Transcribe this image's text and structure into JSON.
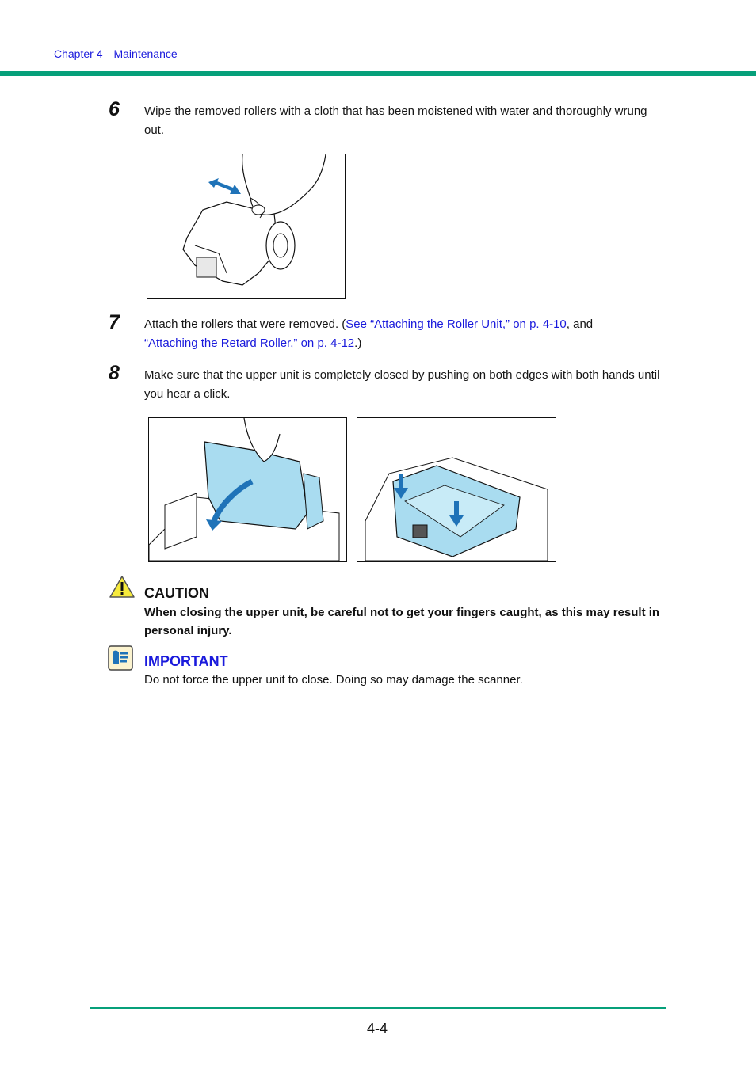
{
  "header": {
    "chapter": "Chapter 4",
    "section": "Maintenance",
    "accent_color": "#06a07a",
    "link_color": "#1a1adc"
  },
  "steps": [
    {
      "number": "6",
      "text": "Wipe the removed rollers with a cloth that has been moistened with water and thoroughly wrung out.",
      "figure": "hand wiping roller unit with cloth, double-headed arrow"
    },
    {
      "number": "7",
      "text_before": "Attach the rollers that were removed. (",
      "link1": "See “Attaching the Roller Unit,” on p. 4-10",
      "text_middle": ", and",
      "link2": "“Attaching the Retard Roller,” on p. 4-12",
      "text_after": ".)"
    },
    {
      "number": "8",
      "text": "Make sure that the upper unit is completely closed by pushing on both edges with both hands until you hear a click.",
      "figures": [
        "closing upper unit with curved arrow",
        "pushing down on both edges of closed upper unit"
      ]
    }
  ],
  "caution": {
    "icon": "warning-triangle-icon",
    "title": "CAUTION",
    "text": "When closing the upper unit, be careful not to get your fingers caught, as this may result in personal injury."
  },
  "important": {
    "icon": "important-hand-icon",
    "title": "IMPORTANT",
    "text": "Do not force the upper unit to close. Doing so may damage the scanner."
  },
  "footer": {
    "page_number": "4-4"
  }
}
